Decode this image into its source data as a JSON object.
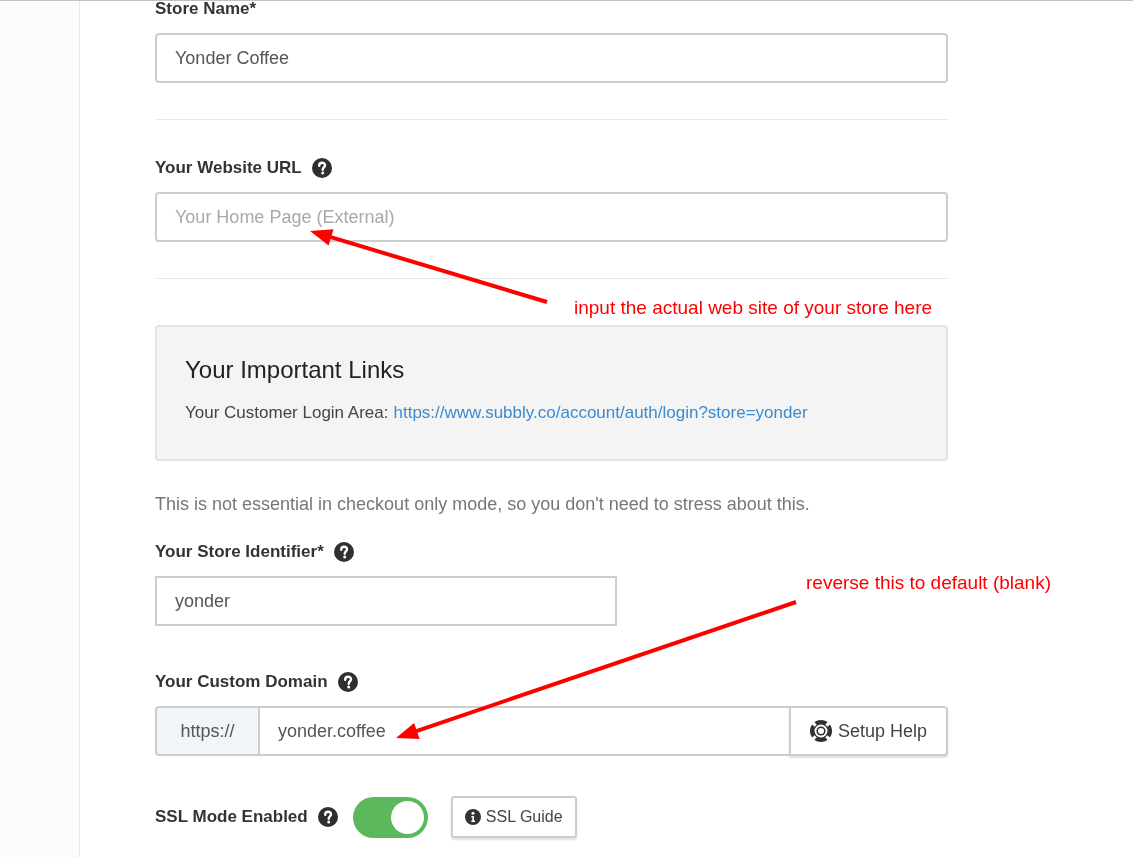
{
  "form_items": [
    {
      "kind": "text_field",
      "label": "Store Name*",
      "help_icon": false,
      "value": "Yonder Coffee"
    },
    {
      "kind": "divider"
    },
    {
      "kind": "text_field",
      "label": "Your Website URL",
      "help_icon": true,
      "placeholder": "Your Home Page (External)"
    },
    {
      "kind": "divider"
    },
    {
      "kind": "links_panel",
      "title": "Your Important Links",
      "label": "Your Customer Login Area:",
      "link": "https://www.subbly.co/account/auth/login?store=yonder"
    },
    {
      "kind": "note",
      "text": "This is not essential in checkout only mode, so you don't need to stress about this."
    },
    {
      "kind": "narrow_field",
      "label": "Your Store Identifier*",
      "help_icon": true,
      "value": "yonder"
    },
    {
      "kind": "addon_field",
      "label": "Your Custom Domain",
      "help_icon": true,
      "prefix": "https://",
      "value": "yonder.coffee",
      "button": "Setup Help"
    },
    {
      "kind": "toggle_field",
      "label": "SSL Mode Enabled",
      "help_icon": true,
      "on": true,
      "button": "SSL Guide"
    }
  ],
  "annotations": [
    {
      "text": "input the actual web site of your store here"
    },
    {
      "text": "reverse this to default (blank)"
    }
  ]
}
